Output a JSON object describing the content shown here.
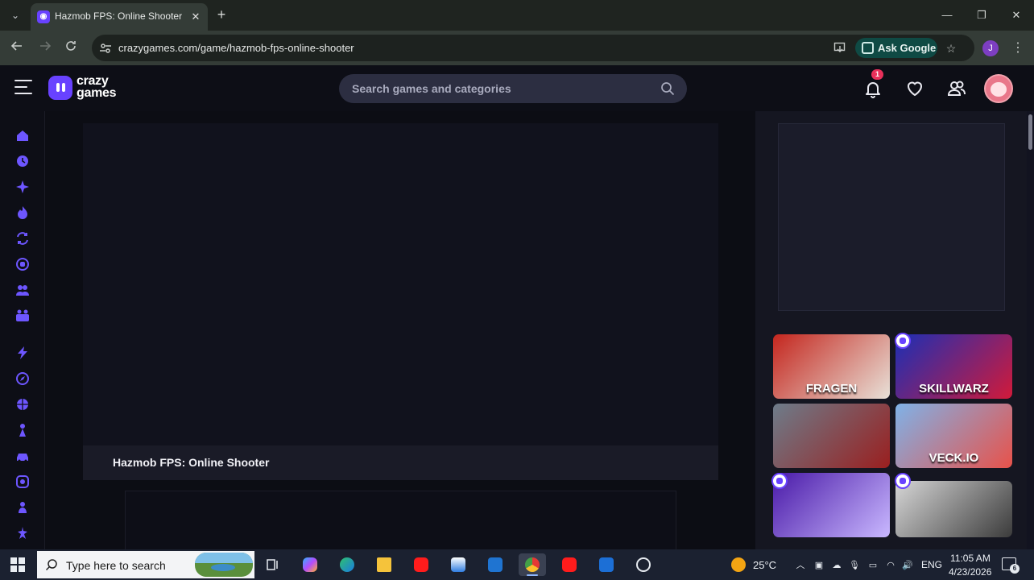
{
  "browser": {
    "tab": {
      "title": "Hazmob FPS: Online Shooter",
      "close": "✕",
      "favicon": "crazygames-favicon"
    },
    "new_tab": "+",
    "window": {
      "minimize": "—",
      "maximize": "❐",
      "close": "✕"
    },
    "url": "crazygames.com/game/hazmob-fps-online-shooter",
    "ask_google": "Ask Google",
    "profile_initial": "J"
  },
  "site": {
    "logo_line1": "crazy",
    "logo_line2": "games",
    "search_placeholder": "Search games and categories",
    "notification_count": "1",
    "sidebar_icons": [
      "home-icon",
      "recent-icon",
      "new-icon",
      "trending-icon",
      "updated-icon",
      "originals-icon",
      "multiplayer-icon",
      "two-player-icon",
      "action-icon",
      "adventure-icon",
      "basketball-icon",
      "beauty-icon",
      "car-icon",
      "casual-icon",
      "clicker-icon",
      "driving-icon"
    ]
  },
  "game": {
    "title": "Hazmob FPS: Online Shooter"
  },
  "recommended": [
    {
      "label": "FRAGEN",
      "colors": [
        "#c4261e",
        "#e8e1d8"
      ]
    },
    {
      "label": "SKILLWARZ",
      "colors": [
        "#1b2fb5",
        "#d11a3a"
      ],
      "live": true
    },
    {
      "label": "",
      "colors": [
        "#6d7c8a",
        "#9a1f1f"
      ]
    },
    {
      "label": "VECK.IO",
      "colors": [
        "#7fb2e8",
        "#e8524a"
      ]
    },
    {
      "label": "",
      "colors": [
        "#4a1aa8",
        "#c9b8ff"
      ],
      "live": true
    },
    {
      "label": "",
      "colors": [
        "#d6d6d6",
        "#3b3b3b"
      ],
      "live": true
    }
  ],
  "taskbar": {
    "search_placeholder": "Type here to search",
    "weather": "25°C",
    "language": "ENG",
    "time": "11:05 AM",
    "date": "4/23/2026",
    "notifications": "6"
  }
}
